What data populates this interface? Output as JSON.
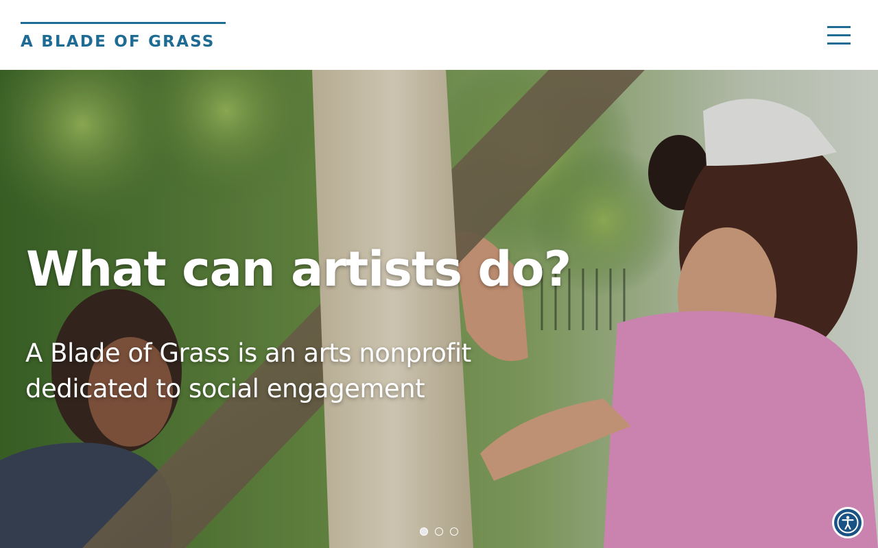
{
  "header": {
    "logo_text": "A BLADE OF GRASS",
    "menu_icon": "hamburger-menu-icon",
    "brand_color": "#1e6b93"
  },
  "hero": {
    "title": "What can artists do?",
    "subtitle": "A Blade of Grass is an arts nonprofit dedicated to social engagement",
    "carousel": {
      "slide_count": 3,
      "active_slide": 1
    }
  },
  "accessibility": {
    "icon": "accessibility-icon",
    "color": "#1a5383"
  }
}
